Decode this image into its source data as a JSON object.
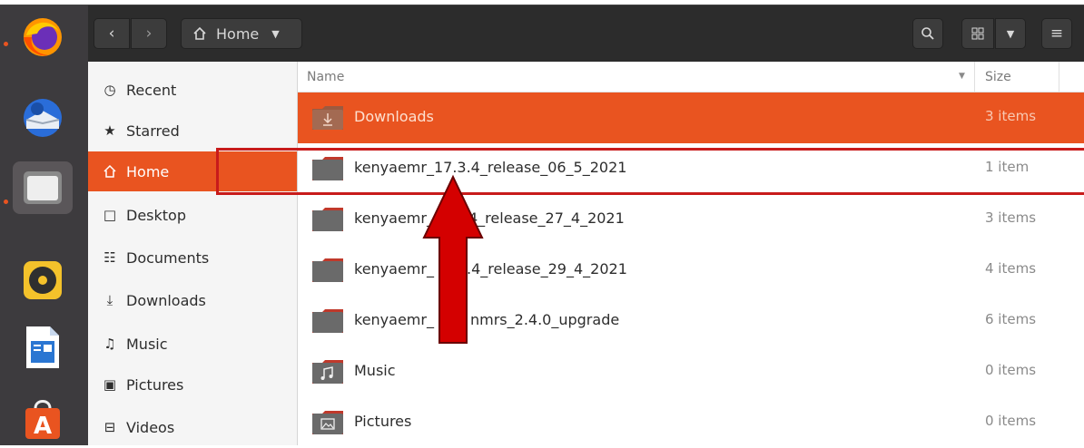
{
  "header": {
    "back_icon": "chevron-left-icon",
    "forward_icon": "chevron-right-icon",
    "location_label": "Home",
    "search_icon": "search-icon",
    "view_icon": "grid-view-icon",
    "menu_icon": "hamburger-menu-icon"
  },
  "dock": {
    "items": [
      "firefox",
      "thunderbird",
      "files",
      "rhythmbox",
      "libreoffice-writer",
      "ubuntu-software"
    ]
  },
  "sidebar": {
    "items": [
      {
        "label": "Recent",
        "icon": "clock-icon"
      },
      {
        "label": "Starred",
        "icon": "star-icon"
      },
      {
        "label": "Home",
        "icon": "home-icon",
        "selected": true
      },
      {
        "label": "Desktop",
        "icon": "desktop-icon"
      },
      {
        "label": "Documents",
        "icon": "document-icon"
      },
      {
        "label": "Downloads",
        "icon": "download-icon"
      },
      {
        "label": "Music",
        "icon": "music-icon"
      },
      {
        "label": "Pictures",
        "icon": "picture-icon"
      },
      {
        "label": "Videos",
        "icon": "video-icon"
      }
    ]
  },
  "list": {
    "columns": {
      "name": "Name",
      "size": "Size"
    },
    "rows": [
      {
        "name": "Downloads",
        "size": "3 items",
        "selected": true,
        "emblem": "download"
      },
      {
        "name": "kenyaemr_17.3.4_release_06_5_2021",
        "size": "1 item"
      },
      {
        "name": "kenyaemr_",
        "name_tail": "4_release_27_4_2021",
        "size": "3 items"
      },
      {
        "name": "kenyaemr_",
        "name_tail": ".4_release_29_4_2021",
        "size": "4 items"
      },
      {
        "name": "kenyaemr_",
        "name_tail": "nmrs_2.4.0_upgrade",
        "size": "6 items"
      },
      {
        "name": "Music",
        "size": "0 items",
        "emblem": "music"
      },
      {
        "name": "Pictures",
        "size": "0 items",
        "emblem": "picture"
      }
    ]
  },
  "colors": {
    "accent": "#e95420",
    "highlight": "#c81b1b",
    "arrow": "#d40000"
  }
}
